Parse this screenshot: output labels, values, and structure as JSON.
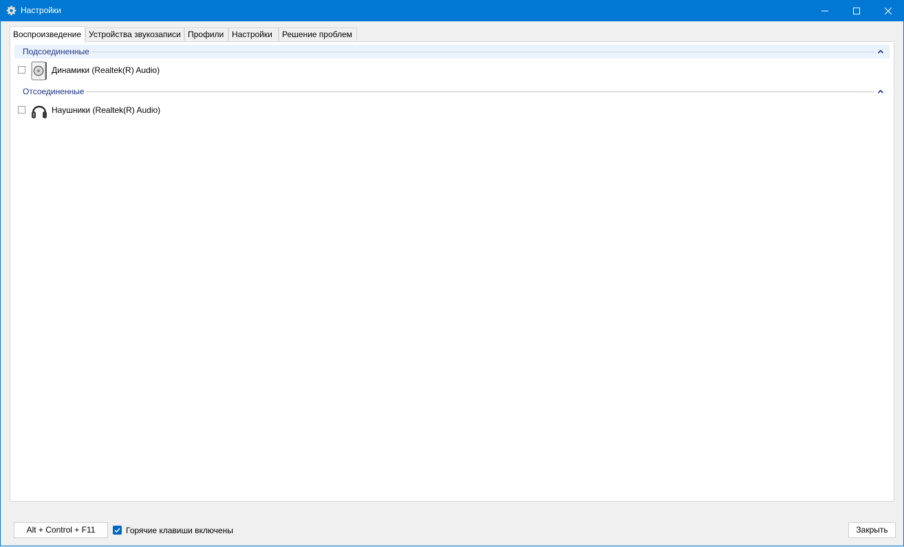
{
  "window": {
    "title": "Настройки",
    "icon": "gear-icon",
    "accent_color": "#0078d4"
  },
  "tabs": [
    {
      "label": "Воспроизведение",
      "active": true
    },
    {
      "label": "Устройства звукозаписи",
      "active": false
    },
    {
      "label": "Профили",
      "active": false
    },
    {
      "label": "Настройки",
      "active": false
    },
    {
      "label": "Решение проблем",
      "active": false
    }
  ],
  "groups": {
    "connected": {
      "title": "Подсоединенные",
      "collapse_icon": "chevron-up-icon",
      "devices": [
        {
          "label": "Динамики (Realtek(R) Audio)",
          "icon": "speaker-icon",
          "checked": false
        }
      ]
    },
    "disconnected": {
      "title": "Отсоединенные",
      "collapse_icon": "chevron-up-icon",
      "devices": [
        {
          "label": "Наушники (Realtek(R) Audio)",
          "icon": "headphones-icon",
          "checked": false
        }
      ]
    }
  },
  "footer": {
    "hotkey_button": "Alt + Control + F11",
    "hotkeys_enabled_label": "Горячие клавиши включены",
    "hotkeys_enabled": true,
    "close_button": "Закрыть"
  }
}
